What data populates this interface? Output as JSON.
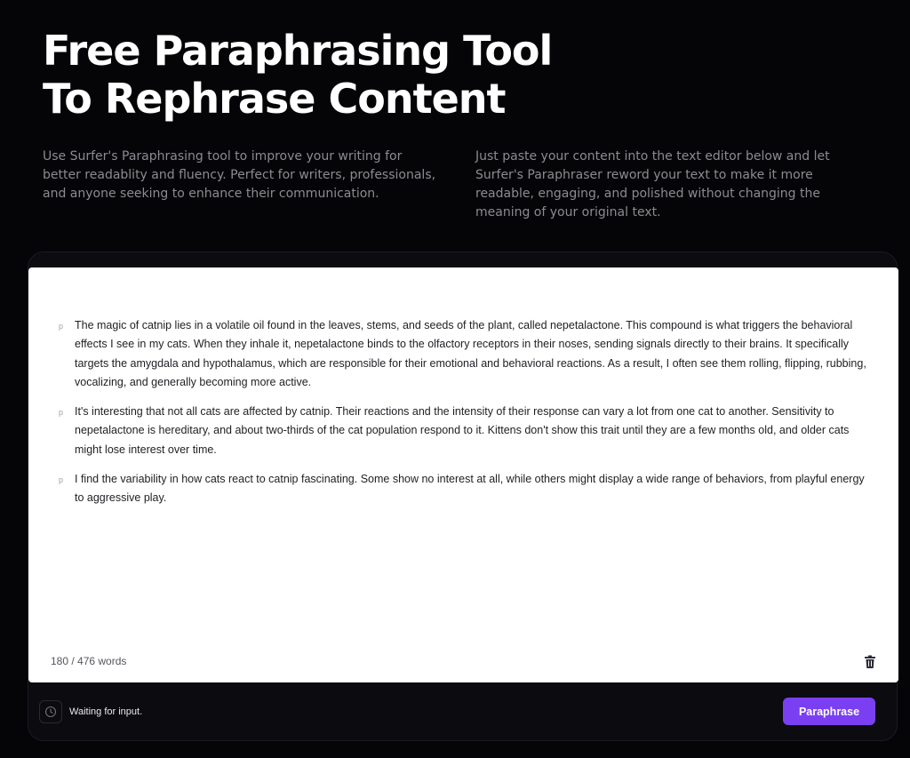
{
  "hero": {
    "title_line1": "Free Paraphrasing Tool",
    "title_line2": "To Rephrase Content"
  },
  "descriptions": {
    "left": "Use Surfer's Paraphrasing tool to improve your writing for better readablity and fluency. Perfect for writers, professionals, and anyone seeking to enhance their communication.",
    "right": "Just paste your content into the text editor below and let Surfer's Paraphraser reword your text to make it more readable, engaging, and polished without changing the meaning of your original text."
  },
  "editor": {
    "paragraph_marker": "p",
    "paragraphs": [
      "The magic of catnip lies in a volatile oil found in the leaves, stems, and seeds of the plant, called nepetalactone. This compound is what triggers the behavioral effects I see in my cats. When they inhale it, nepetalactone binds to the olfactory receptors in their noses, sending signals directly to their brains. It specifically targets the amygdala and hypothalamus, which are responsible for their emotional and behavioral reactions. As a result, I often see them rolling, flipping, rubbing, vocalizing, and generally becoming more active.",
      "It's interesting that not all cats are affected by catnip. Their reactions and the intensity of their response can vary a lot from one cat to another. Sensitivity to nepetalactone is hereditary, and about two-thirds of the cat population respond to it. Kittens don't show this trait until they are a few months old, and older cats might lose interest over time.",
      "I find the variability in how cats react to catnip fascinating. Some show no interest at all, while others might display a wide range of behaviors, from playful energy to aggressive play."
    ],
    "word_count": "180 / 476 words",
    "delete_icon": "trash-icon"
  },
  "footer": {
    "status_icon": "clock-icon",
    "status_text": "Waiting for input.",
    "paraphrase_label": "Paraphrase"
  },
  "colors": {
    "background": "#050507",
    "accent": "#7b3ff2"
  }
}
